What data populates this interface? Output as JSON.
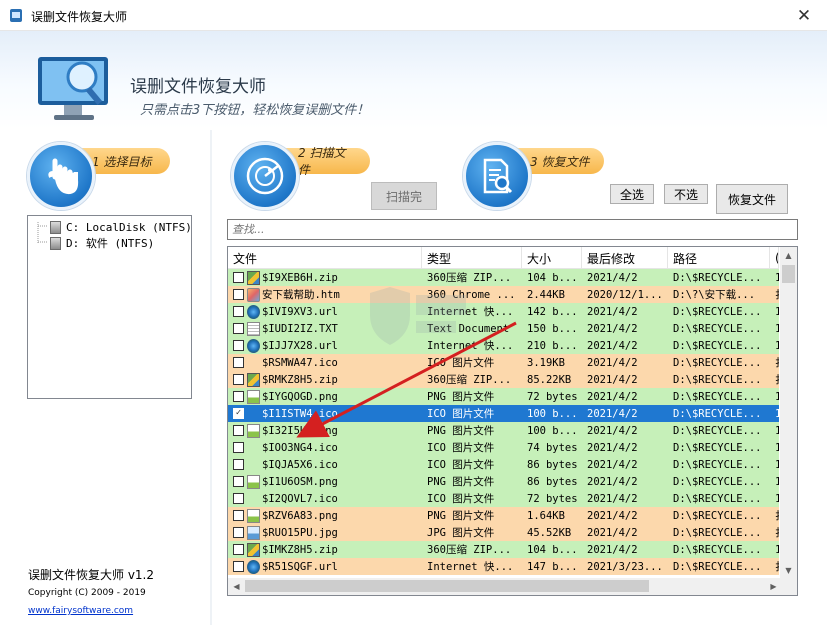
{
  "window": {
    "title": "误删文件恢复大师"
  },
  "banner": {
    "title": "误删文件恢复大师",
    "subtitle": "只需点击3下按钮，轻松恢复误删文件！"
  },
  "steps": [
    {
      "label": "1 选择目标"
    },
    {
      "label": "2 扫描文件"
    },
    {
      "label": "3 恢复文件"
    }
  ],
  "buttons": {
    "scan_done": "扫描完",
    "select_all": "全选",
    "select_none": "不选",
    "recover": "恢复文件"
  },
  "drives": [
    {
      "label": "C: LocalDisk (NTFS)"
    },
    {
      "label": "D: 软件 (NTFS)"
    }
  ],
  "search": {
    "placeholder": "查找..."
  },
  "table": {
    "columns": [
      "文件",
      "类型",
      "大小",
      "最后修改",
      "路径",
      "("
    ],
    "rows": [
      {
        "icon": "zip",
        "checked": false,
        "name": "$I9XEB6H.zip",
        "type": "360压缩 ZIP...",
        "size": "104 b...",
        "date": "2021/4/2",
        "path": "D:\\$RECYCLE...",
        "more": "1",
        "color": "green"
      },
      {
        "icon": "htm",
        "checked": false,
        "name": "安下载帮助.htm",
        "type": "360 Chrome ...",
        "size": "2.44KB",
        "date": "2020/12/1...",
        "path": "D:\\?\\安下载...",
        "more": "扌",
        "color": "orange"
      },
      {
        "icon": "url",
        "checked": false,
        "name": "$IVI9XV3.url",
        "type": "Internet 快...",
        "size": "142 b...",
        "date": "2021/4/2",
        "path": "D:\\$RECYCLE...",
        "more": "1",
        "color": "green"
      },
      {
        "icon": "txt",
        "checked": false,
        "name": "$IUDI2IZ.TXT",
        "type": "Text Document",
        "size": "150 b...",
        "date": "2021/4/2",
        "path": "D:\\$RECYCLE...",
        "more": "1",
        "color": "green"
      },
      {
        "icon": "url",
        "checked": false,
        "name": "$IJJ7X28.url",
        "type": "Internet 快...",
        "size": "210 b...",
        "date": "2021/4/2",
        "path": "D:\\$RECYCLE...",
        "more": "1",
        "color": "green"
      },
      {
        "icon": "blank",
        "checked": false,
        "name": "$RSMWA47.ico",
        "type": "ICO 图片文件",
        "size": "3.19KB",
        "date": "2021/4/2",
        "path": "D:\\$RECYCLE...",
        "more": "扌",
        "color": "orange"
      },
      {
        "icon": "zip",
        "checked": false,
        "name": "$RMKZ8H5.zip",
        "type": "360压缩 ZIP...",
        "size": "85.22KB",
        "date": "2021/4/2",
        "path": "D:\\$RECYCLE...",
        "more": "扌",
        "color": "orange"
      },
      {
        "icon": "png",
        "checked": false,
        "name": "$IYGQOGD.png",
        "type": "PNG 图片文件",
        "size": "72 bytes",
        "date": "2021/4/2",
        "path": "D:\\$RECYCLE...",
        "more": "1",
        "color": "green"
      },
      {
        "icon": "blank",
        "checked": true,
        "name": "$I1ISTW4.ico",
        "type": "ICO 图片文件",
        "size": "100 b...",
        "date": "2021/4/2",
        "path": "D:\\$RECYCLE...",
        "more": "1",
        "color": "selected"
      },
      {
        "icon": "png",
        "checked": false,
        "name": "$I32I5U9.png",
        "type": "PNG 图片文件",
        "size": "100 b...",
        "date": "2021/4/2",
        "path": "D:\\$RECYCLE...",
        "more": "1",
        "color": "green"
      },
      {
        "icon": "blank",
        "checked": false,
        "name": "$IOO3NG4.ico",
        "type": "ICO 图片文件",
        "size": "74 bytes",
        "date": "2021/4/2",
        "path": "D:\\$RECYCLE...",
        "more": "1",
        "color": "green"
      },
      {
        "icon": "blank",
        "checked": false,
        "name": "$IQJA5X6.ico",
        "type": "ICO 图片文件",
        "size": "86 bytes",
        "date": "2021/4/2",
        "path": "D:\\$RECYCLE...",
        "more": "1",
        "color": "green"
      },
      {
        "icon": "png",
        "checked": false,
        "name": "$I1U6OSM.png",
        "type": "PNG 图片文件",
        "size": "86 bytes",
        "date": "2021/4/2",
        "path": "D:\\$RECYCLE...",
        "more": "1",
        "color": "green"
      },
      {
        "icon": "blank",
        "checked": false,
        "name": "$I2QOVL7.ico",
        "type": "ICO 图片文件",
        "size": "72 bytes",
        "date": "2021/4/2",
        "path": "D:\\$RECYCLE...",
        "more": "1",
        "color": "green"
      },
      {
        "icon": "png",
        "checked": false,
        "name": "$RZV6A83.png",
        "type": "PNG 图片文件",
        "size": "1.64KB",
        "date": "2021/4/2",
        "path": "D:\\$RECYCLE...",
        "more": "扌",
        "color": "orange"
      },
      {
        "icon": "jpg",
        "checked": false,
        "name": "$RUO15PU.jpg",
        "type": "JPG 图片文件",
        "size": "45.52KB",
        "date": "2021/4/2",
        "path": "D:\\$RECYCLE...",
        "more": "扌",
        "color": "orange"
      },
      {
        "icon": "zip",
        "checked": false,
        "name": "$IMKZ8H5.zip",
        "type": "360压缩 ZIP...",
        "size": "104 b...",
        "date": "2021/4/2",
        "path": "D:\\$RECYCLE...",
        "more": "1",
        "color": "green"
      },
      {
        "icon": "url",
        "checked": false,
        "name": "$R51SQGF.url",
        "type": "Internet 快...",
        "size": "147 b...",
        "date": "2021/3/23...",
        "path": "D:\\$RECYCLE...",
        "more": "扌",
        "color": "orange"
      }
    ]
  },
  "about": {
    "title": "误删文件恢复大师 v1.2",
    "copyright": "Copyright (C) 2009 - 2019",
    "link": "www.fairysoftware.com"
  },
  "colors": {
    "row_green": "#c6f0b9",
    "row_orange": "#fcd8ac",
    "row_selected": "#1f78d1",
    "step_pill": "#f7b74b",
    "step_circle": "#1f77c9",
    "annotation_arrow": "#d42020"
  },
  "icons": {
    "app": "app-icon",
    "close": "close-icon",
    "step1": "hand-pointer-icon",
    "step2": "radar-scan-icon",
    "step3": "document-search-icon",
    "drive": "hard-disk-icon"
  }
}
